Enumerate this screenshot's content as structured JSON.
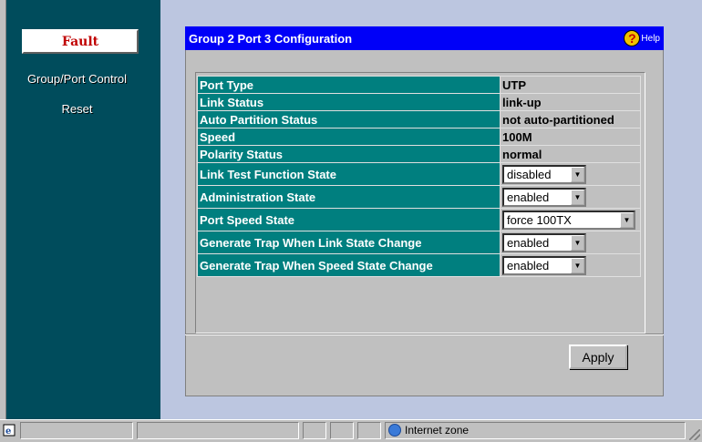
{
  "sidebar": {
    "fault_label": "Fault",
    "items": [
      {
        "label": "Group/Port Control"
      },
      {
        "label": "Reset"
      }
    ]
  },
  "panel": {
    "title": "Group 2 Port 3 Configuration",
    "help_label": "Help",
    "help_icon": "?"
  },
  "rows": [
    {
      "label": "Port Type",
      "value": "UTP"
    },
    {
      "label": "Link Status",
      "value": "link-up"
    },
    {
      "label": "Auto Partition Status",
      "value": "not auto-partitioned"
    },
    {
      "label": "Speed",
      "value": "100M"
    },
    {
      "label": "Polarity Status",
      "value": "normal"
    }
  ],
  "selects": [
    {
      "label": "Link Test Function State",
      "value": "disabled"
    },
    {
      "label": "Administration State",
      "value": "enabled"
    },
    {
      "label": "Port Speed State",
      "value": "force 100TX"
    },
    {
      "label": "Generate Trap When Link State Change",
      "value": "enabled"
    },
    {
      "label": "Generate Trap When Speed State Change",
      "value": "enabled"
    }
  ],
  "apply_label": "Apply",
  "statusbar": {
    "zone": "Internet zone"
  },
  "colors": {
    "sidebar": "#004c5c",
    "titlebar": "#0000f8",
    "label_cell": "#007f7f",
    "fault_text": "#c00000"
  }
}
